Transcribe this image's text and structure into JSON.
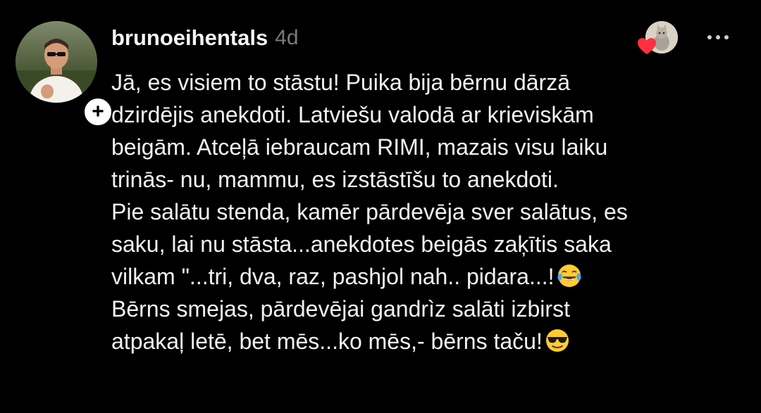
{
  "comment": {
    "username": "brunoeihentals",
    "timestamp": "4d",
    "follow_symbol": "+",
    "lines": [
      "Jā, es visiem to stāstu! Puika bija bērnu dārzā",
      "dzirdējis anekdoti. Latviešu valodā ar krieviskām",
      "beigām. Atceļā iebraucam RIMI, mazais visu laiku",
      "trinās- nu, mammu, es izstāstīšu to anekdoti.",
      "Pie salātu stenda, kamēr pārdevēja sver salātus, es",
      "saku, lai nu stāsta...anekdotes beigās zaķītis saka",
      "vilkam \"...tri, dva, raz, pashjol nah.. pidara...!",
      "Bērns smejas, pārdevējai gandrìz salāti izbirst",
      "atpakaļ letē, bet mēs...ko mēs,- bērns taču!"
    ],
    "line7_emoji": "tears-of-joy-emoji",
    "line9_emoji": "sunglasses-emoji"
  },
  "icons": {
    "liked_by_author": "heart-icon",
    "more": "more-options-icon"
  },
  "colors": {
    "background": "#000000",
    "text": "#f2f2f2",
    "muted": "#7a7a7a",
    "heart": "#ff3040"
  }
}
